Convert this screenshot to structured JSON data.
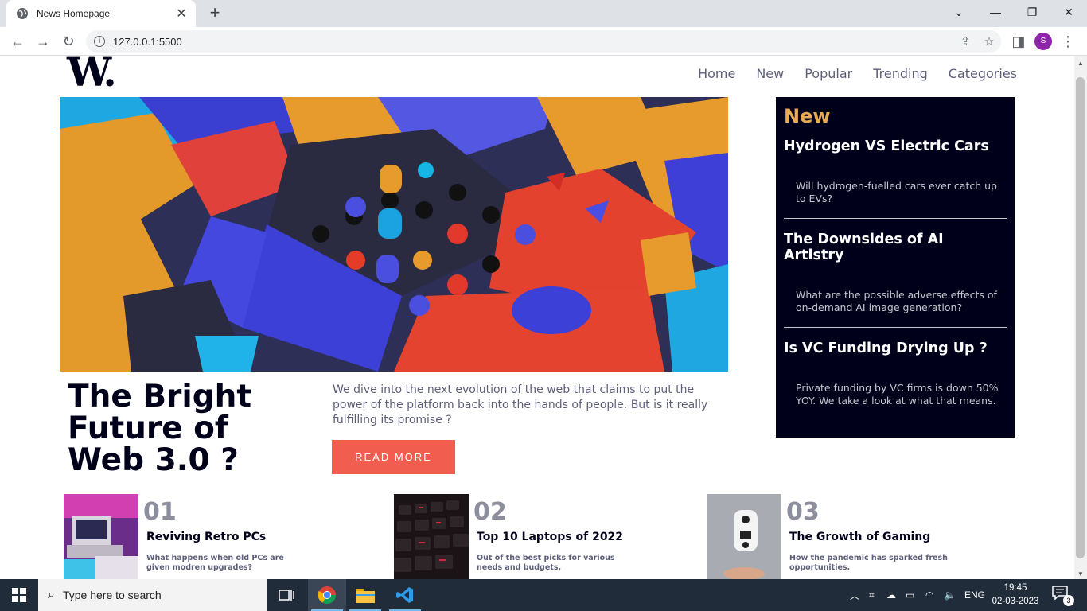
{
  "browser": {
    "tab_title": "News Homepage",
    "url": "127.0.0.1:5500",
    "profile_initial": "S"
  },
  "site": {
    "logo": "W.",
    "nav": [
      "Home",
      "New",
      "Popular",
      "Trending",
      "Categories"
    ]
  },
  "hero": {
    "headline": "The Bright Future of Web 3.0 ?",
    "summary": "We dive into the next evolution of the web that claims to put the power of the platform back into the hands of people. But is it really fulfilling its promise ?",
    "cta": "READ MORE"
  },
  "sidebar": {
    "title": "New",
    "items": [
      {
        "title": "Hydrogen VS Electric Cars",
        "desc": "Will hydrogen-fuelled cars ever catch up to EVs?"
      },
      {
        "title": "The Downsides of AI Artistry",
        "desc": "What are the possible adverse effects of on-demand AI image generation?"
      },
      {
        "title": "Is VC Funding Drying Up ?",
        "desc": "Private funding by VC firms is down 50% YOY. We take a look at what that means."
      }
    ]
  },
  "cards": [
    {
      "num": "01",
      "title": "Reviving Retro PCs",
      "desc": "What happens when old PCs are given modren upgrades?"
    },
    {
      "num": "02",
      "title": "Top 10 Laptops of 2022",
      "desc": "Out of the best picks for various needs and budgets."
    },
    {
      "num": "03",
      "title": "The Growth of Gaming",
      "desc": "How the pandemic has sparked fresh opportunities."
    }
  ],
  "taskbar": {
    "search_placeholder": "Type here to search",
    "language": "ENG",
    "time": "19:45",
    "date": "02-03-2023",
    "notifications": "3"
  },
  "colors": {
    "accent": "#f15e50",
    "sidebar_bg": "#00001a",
    "sidebar_title": "#e9ab53"
  }
}
